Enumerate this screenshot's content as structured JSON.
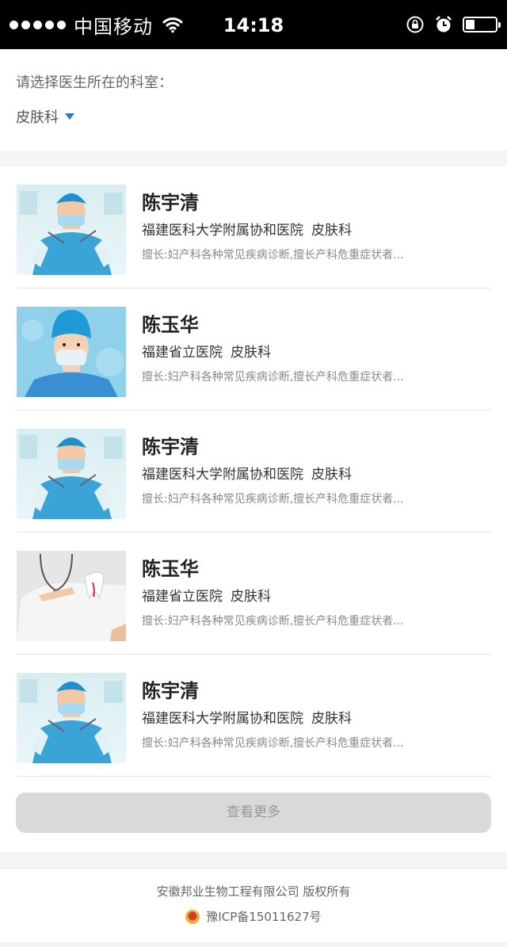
{
  "status_bar": {
    "carrier": "中国移动",
    "time": "14:18",
    "battery_level": 0.3
  },
  "department": {
    "prompt": "请选择医生所在的科室：",
    "selected": "皮肤科"
  },
  "doctors": [
    {
      "name": "陈宇清",
      "hospital": "福建医科大学附属协和医院",
      "dept": "皮肤科",
      "skill": "擅长:妇产科各种常见疾病诊断,擅长产科危重症状者...",
      "photo": "male-doctor-mask"
    },
    {
      "name": "陈玉华",
      "hospital": "福建省立医院",
      "dept": "皮肤科",
      "skill": "擅长:妇产科各种常见疾病诊断,擅长产科危重症状者...",
      "photo": "female-nurse-mask"
    },
    {
      "name": "陈宇清",
      "hospital": "福建医科大学附属协和医院",
      "dept": "皮肤科",
      "skill": "擅长:妇产科各种常见疾病诊断,擅长产科危重症状者...",
      "photo": "male-doctor-mask"
    },
    {
      "name": "陈玉华",
      "hospital": "福建省立医院",
      "dept": "皮肤科",
      "skill": "擅长:妇产科各种常见疾病诊断,擅长产科危重症状者...",
      "photo": "dentist-tooth"
    },
    {
      "name": "陈宇清",
      "hospital": "福建医科大学附属协和医院",
      "dept": "皮肤科",
      "skill": "擅长:妇产科各种常见疾病诊断,擅长产科危重症状者...",
      "photo": "male-doctor-mask"
    }
  ],
  "more_button": "查看更多",
  "footer": {
    "copyright": "安徽邦业生物工程有限公司 版权所有",
    "icp": "豫ICP备15011627号"
  }
}
